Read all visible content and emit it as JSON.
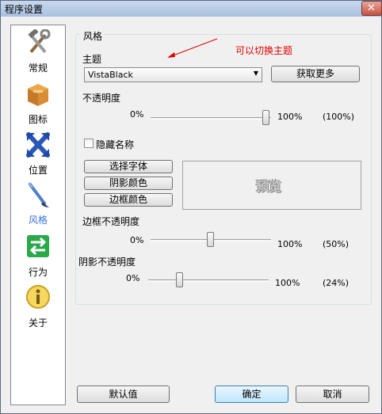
{
  "window": {
    "title": "程序设置",
    "close_icon": "close-icon"
  },
  "sidebar": {
    "items": [
      {
        "label": "常规",
        "icon": "tools-icon"
      },
      {
        "label": "图标",
        "icon": "package-icon"
      },
      {
        "label": "位置",
        "icon": "position-arrows-icon"
      },
      {
        "label": "风格",
        "icon": "brush-icon",
        "selected": true
      },
      {
        "label": "行为",
        "icon": "behavior-arrows-icon"
      },
      {
        "label": "关于",
        "icon": "info-icon"
      }
    ]
  },
  "style_group": {
    "title": "风格",
    "theme_label": "主题",
    "theme_value": "VistaBlack",
    "get_more_button": "获取更多",
    "annotation": "可以切换主题",
    "opacity_label": "不透明度",
    "opacity_min": "0%",
    "opacity_max": "100%",
    "opacity_value": "(100%)",
    "hide_name_label": "隐藏名称",
    "hide_name_checked": false,
    "choose_font_button": "选择字体",
    "shadow_color_button": "阴影颜色",
    "border_color_button": "边框颜色",
    "preview_text": "预览",
    "border_opacity_label": "边框不透明度",
    "border_opacity_min": "0%",
    "border_opacity_max": "100%",
    "border_opacity_value": "(50%)",
    "shadow_opacity_label": "阴影不透明度",
    "shadow_opacity_min": "0%",
    "shadow_opacity_max": "100%",
    "shadow_opacity_value": "(24%)"
  },
  "footer": {
    "default_button": "默认值",
    "ok_button": "确定",
    "cancel_button": "取消"
  },
  "colors": {
    "annotation": "#e00000",
    "selected_item": "#3a73d9"
  }
}
